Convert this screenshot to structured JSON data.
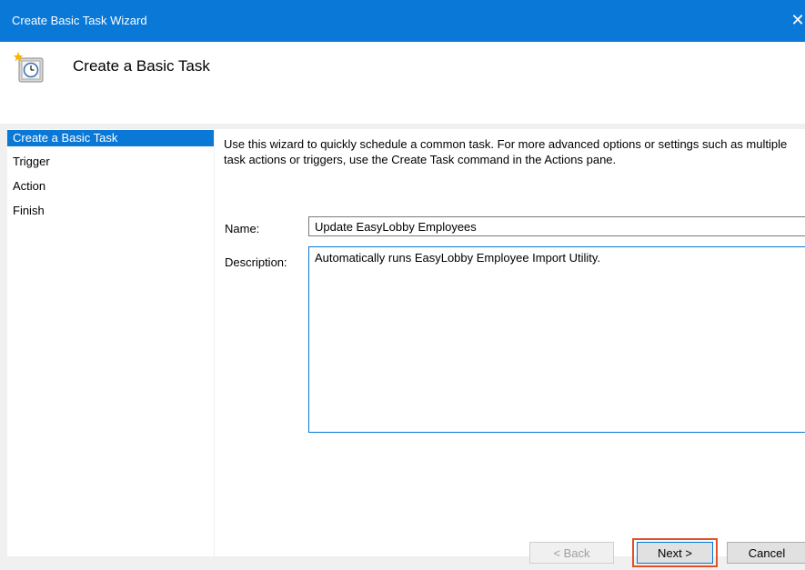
{
  "window": {
    "title": "Create Basic Task Wizard",
    "close_glyph": "✕"
  },
  "header": {
    "title": "Create a Basic Task",
    "icon": "scheduled-task-clock-icon"
  },
  "steps": [
    {
      "label": "Create a Basic Task",
      "active": true
    },
    {
      "label": "Trigger",
      "active": false
    },
    {
      "label": "Action",
      "active": false
    },
    {
      "label": "Finish",
      "active": false
    }
  ],
  "content": {
    "intro": "Use this wizard to quickly schedule a common task.  For more advanced options or settings such as multiple task actions or triggers, use the Create Task command in the Actions pane.",
    "name_label": "Name:",
    "name_value": "Update EasyLobby Employees",
    "description_label": "Description:",
    "description_value": "Automatically runs EasyLobby Employee Import Utility."
  },
  "buttons": {
    "back": "< Back",
    "next": "Next >",
    "cancel": "Cancel"
  },
  "colors": {
    "accent": "#0a78d7",
    "highlight": "#e0512b"
  }
}
